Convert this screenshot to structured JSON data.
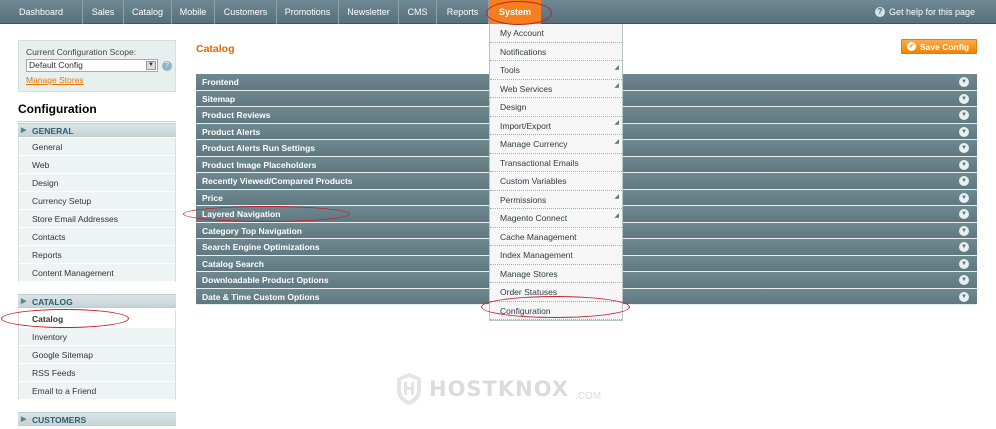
{
  "topnav": {
    "items": [
      {
        "label": "Dashboard"
      },
      {
        "label": "Sales"
      },
      {
        "label": "Catalog"
      },
      {
        "label": "Mobile"
      },
      {
        "label": "Customers"
      },
      {
        "label": "Promotions"
      },
      {
        "label": "Newsletter"
      },
      {
        "label": "CMS"
      },
      {
        "label": "Reports"
      },
      {
        "label": "System"
      }
    ],
    "active": "System",
    "help_text": "Get help for this page"
  },
  "sidebar": {
    "scope_label": "Current Configuration Scope:",
    "scope_value": "Default Config",
    "manage_stores": "Manage Stores",
    "title": "Configuration",
    "groups": [
      {
        "label": "GENERAL",
        "items": [
          "General",
          "Web",
          "Design",
          "Currency Setup",
          "Store Email Addresses",
          "Contacts",
          "Reports",
          "Content Management"
        ]
      },
      {
        "label": "CATALOG",
        "items": [
          "Catalog",
          "Inventory",
          "Google Sitemap",
          "RSS Feeds",
          "Email to a Friend"
        ]
      },
      {
        "label": "CUSTOMERS",
        "items": []
      }
    ],
    "selected": "Catalog"
  },
  "main": {
    "title": "Catalog",
    "save_label": "Save Config",
    "sections": [
      "Frontend",
      "Sitemap",
      "Product Reviews",
      "Product Alerts",
      "Product Alerts Run Settings",
      "Product Image Placeholders",
      "Recently Viewed/Compared Products",
      "Price",
      "Layered Navigation",
      "Category Top Navigation",
      "Search Engine Optimizations",
      "Catalog Search",
      "Downloadable Product Options",
      "Date & Time Custom Options"
    ]
  },
  "system_menu": {
    "items": [
      {
        "label": "My Account",
        "submenu": false
      },
      {
        "label": "Notifications",
        "submenu": false
      },
      {
        "label": "Tools",
        "submenu": true
      },
      {
        "label": "Web Services",
        "submenu": true
      },
      {
        "label": "Design",
        "submenu": false
      },
      {
        "label": "Import/Export",
        "submenu": true
      },
      {
        "label": "Manage Currency",
        "submenu": true
      },
      {
        "label": "Transactional Emails",
        "submenu": false
      },
      {
        "label": "Custom Variables",
        "submenu": false
      },
      {
        "label": "Permissions",
        "submenu": true
      },
      {
        "label": "Magento Connect",
        "submenu": true
      },
      {
        "label": "Cache Management",
        "submenu": false
      },
      {
        "label": "Index Management",
        "submenu": false
      },
      {
        "label": "Manage Stores",
        "submenu": false
      },
      {
        "label": "Order Statuses",
        "submenu": false
      },
      {
        "label": "Configuration",
        "submenu": false
      }
    ]
  },
  "watermark": {
    "text": "HOSTKNOX",
    "suffix": ".COM"
  },
  "colors": {
    "accent": "#f57f1f",
    "nav_bg": "#607a83",
    "section_bg": "#687f86",
    "highlight_ring": "#c4202a"
  }
}
